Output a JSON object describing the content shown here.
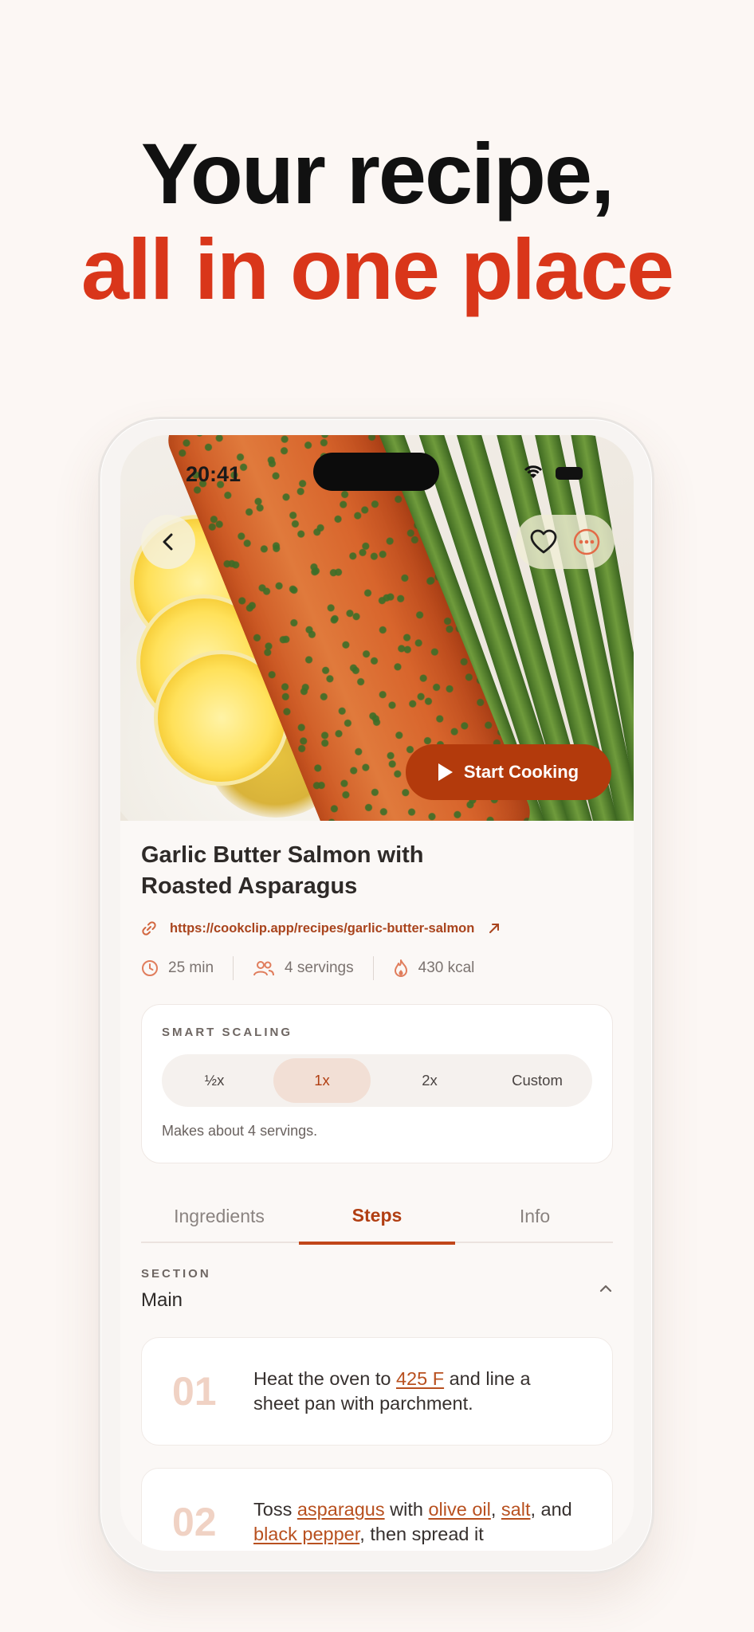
{
  "headline": {
    "line1": "Your recipe,",
    "line2": "all in one place"
  },
  "status_bar": {
    "time": "20:41"
  },
  "hero": {
    "start_cooking_label": "Start Cooking"
  },
  "recipe": {
    "title_line1": "Garlic Butter Salmon with",
    "title_line2": "Roasted Asparagus",
    "url": "https://cookclip.app/recipes/garlic-butter-salmon",
    "time": "25 min",
    "servings": "4 servings",
    "calories": "430 kcal"
  },
  "smart_scaling": {
    "label": "SMART SCALING",
    "options": [
      "½x",
      "1x",
      "2x",
      "Custom"
    ],
    "selected": "1x",
    "note": "Makes about 4 servings."
  },
  "tabs": {
    "items": [
      "Ingredients",
      "Steps",
      "Info"
    ],
    "active": "Steps"
  },
  "section": {
    "label": "SECTION",
    "name": "Main"
  },
  "steps": [
    {
      "number": "01",
      "parts": [
        "Heat the oven to ",
        "425 F",
        " and line a sheet pan with parchment."
      ]
    },
    {
      "number": "02",
      "parts": [
        "Toss ",
        "asparagus",
        " with ",
        "olive oil",
        ", ",
        "salt",
        ", and ",
        "black pepper",
        ", then spread it"
      ]
    }
  ],
  "colors": {
    "accent": "#d9361a",
    "button": "#b33a0c",
    "link": "#b8501f",
    "background": "#fcf7f4"
  },
  "icons": [
    "chevron-left-icon",
    "heart-icon",
    "more-icon",
    "play-icon",
    "link-icon",
    "external-link-icon",
    "clock-icon",
    "people-icon",
    "flame-icon",
    "chevron-up-icon",
    "wifi-icon",
    "battery-icon"
  ]
}
